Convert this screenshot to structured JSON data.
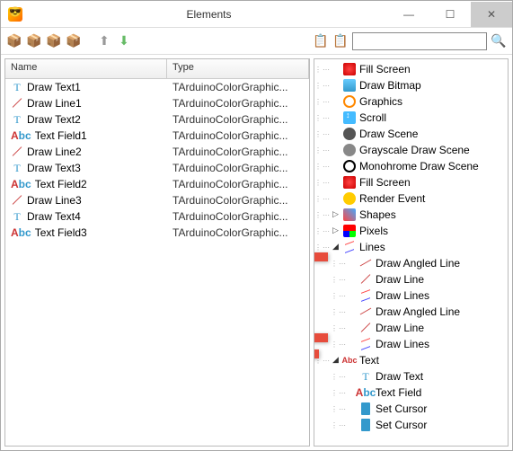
{
  "window": {
    "title": "Elements"
  },
  "left": {
    "columns": {
      "name": "Name",
      "type": "Type"
    },
    "rows": [
      {
        "icon": "drawtext",
        "name": "Draw Text1",
        "type": "TArduinoColorGraphic..."
      },
      {
        "icon": "line",
        "name": "Draw Line1",
        "type": "TArduinoColorGraphic..."
      },
      {
        "icon": "drawtext",
        "name": "Draw Text2",
        "type": "TArduinoColorGraphic..."
      },
      {
        "icon": "textfield",
        "name": "Text Field1",
        "type": "TArduinoColorGraphic..."
      },
      {
        "icon": "line",
        "name": "Draw Line2",
        "type": "TArduinoColorGraphic..."
      },
      {
        "icon": "drawtext",
        "name": "Draw Text3",
        "type": "TArduinoColorGraphic..."
      },
      {
        "icon": "textfield",
        "name": "Text Field2",
        "type": "TArduinoColorGraphic..."
      },
      {
        "icon": "line",
        "name": "Draw Line3",
        "type": "TArduinoColorGraphic..."
      },
      {
        "icon": "drawtext",
        "name": "Draw Text4",
        "type": "TArduinoColorGraphic..."
      },
      {
        "icon": "textfield",
        "name": "Text Field3",
        "type": "TArduinoColorGraphic..."
      }
    ]
  },
  "right": {
    "nodes": [
      {
        "depth": 1,
        "exp": "",
        "icon": "fillscreen",
        "label": "Fill Screen"
      },
      {
        "depth": 1,
        "exp": "",
        "icon": "bitmap",
        "label": "Draw Bitmap"
      },
      {
        "depth": 1,
        "exp": "",
        "icon": "graphics",
        "label": "Graphics"
      },
      {
        "depth": 1,
        "exp": "",
        "icon": "scroll",
        "label": "Scroll"
      },
      {
        "depth": 1,
        "exp": "",
        "icon": "drawscene",
        "label": "Draw Scene"
      },
      {
        "depth": 1,
        "exp": "",
        "icon": "grayscale",
        "label": "Grayscale Draw Scene"
      },
      {
        "depth": 1,
        "exp": "",
        "icon": "mono",
        "label": "Monohrome Draw Scene"
      },
      {
        "depth": 1,
        "exp": "",
        "icon": "fillscreen",
        "label": "Fill Screen"
      },
      {
        "depth": 1,
        "exp": "",
        "icon": "render",
        "label": "Render Event"
      },
      {
        "depth": 1,
        "exp": "▷",
        "icon": "shapes",
        "label": "Shapes"
      },
      {
        "depth": 1,
        "exp": "▷",
        "icon": "pixels",
        "label": "Pixels"
      },
      {
        "depth": 1,
        "exp": "◿",
        "icon": "lines",
        "label": "Lines"
      },
      {
        "depth": 2,
        "exp": "",
        "icon": "angled",
        "label": "Draw Angled Line"
      },
      {
        "depth": 2,
        "exp": "",
        "icon": "line",
        "label": "Draw Line"
      },
      {
        "depth": 2,
        "exp": "",
        "icon": "lines",
        "label": "Draw Lines"
      },
      {
        "depth": 2,
        "exp": "",
        "icon": "angled",
        "label": "Draw Angled Line"
      },
      {
        "depth": 2,
        "exp": "",
        "icon": "line",
        "label": "Draw Line"
      },
      {
        "depth": 2,
        "exp": "",
        "icon": "lines",
        "label": "Draw Lines"
      },
      {
        "depth": 1,
        "exp": "◿",
        "icon": "text",
        "label": "Text"
      },
      {
        "depth": 2,
        "exp": "",
        "icon": "drawtext",
        "label": "Draw Text"
      },
      {
        "depth": 2,
        "exp": "",
        "icon": "textfield",
        "label": "Text Field"
      },
      {
        "depth": 2,
        "exp": "",
        "icon": "cursor",
        "label": "Set Cursor"
      },
      {
        "depth": 2,
        "exp": "",
        "icon": "cursor",
        "label": "Set Cursor"
      }
    ]
  }
}
